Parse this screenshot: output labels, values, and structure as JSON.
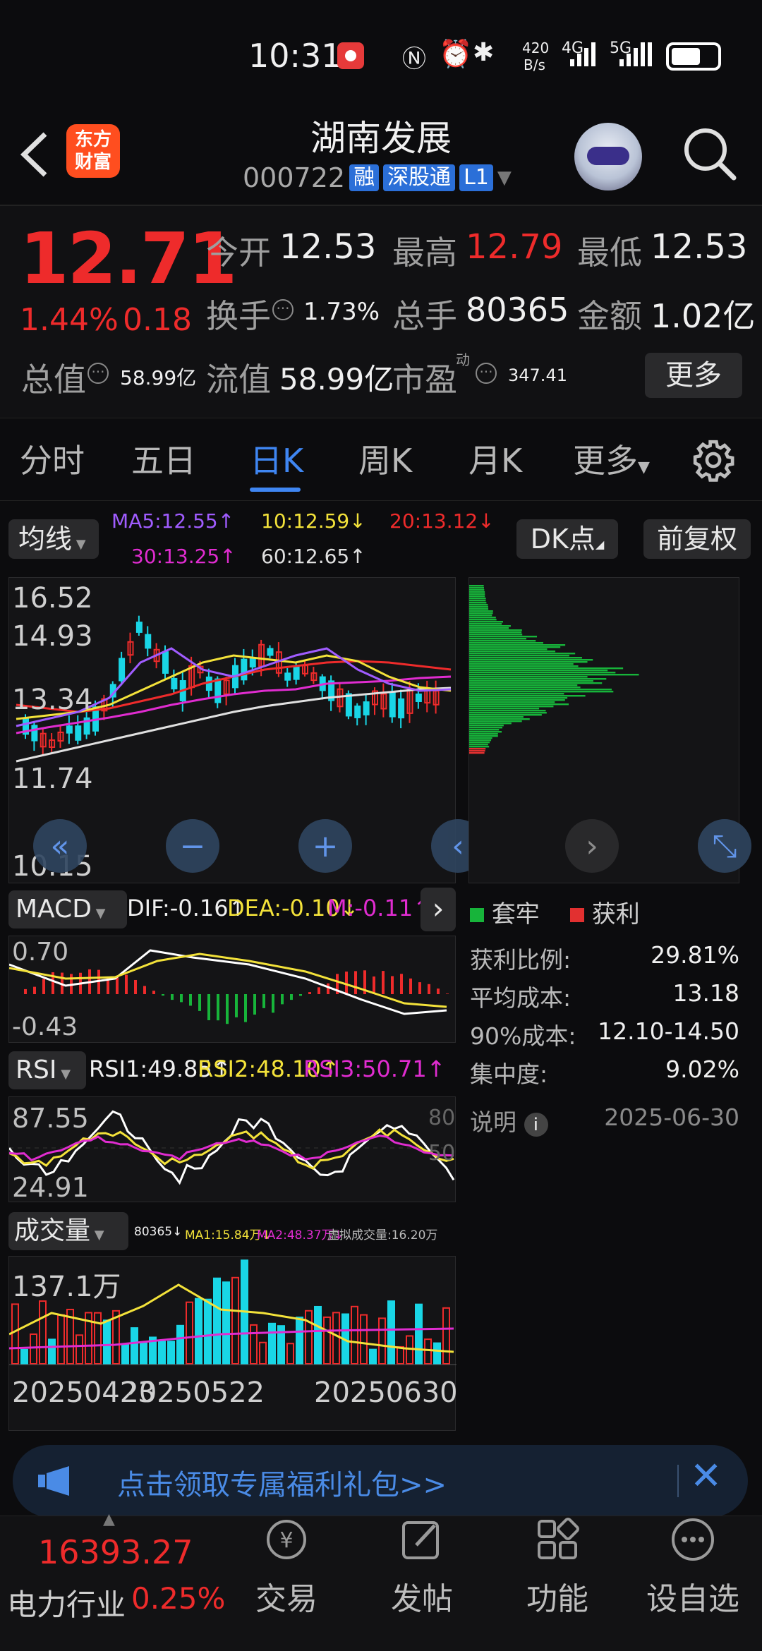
{
  "status_bar": {
    "time": "10:31",
    "net_speed_top": "420",
    "net_speed_bottom": "B/s",
    "sig1": "4G",
    "sig2": "5G"
  },
  "header": {
    "title": "湖南发展",
    "code": "000722",
    "badges": [
      "融",
      "深股通",
      "L1"
    ],
    "logo_line1": "东方",
    "logo_line2": "财富"
  },
  "quote": {
    "price": "12.71",
    "change_pct": "1.44%",
    "change": "0.18",
    "open_label": "今开",
    "open": "12.53",
    "high_label": "最高",
    "high": "12.79",
    "low_label": "最低",
    "low": "12.53",
    "turnover_label": "换手",
    "turnover": "1.73%",
    "volume_label": "总手",
    "volume": "80365",
    "amount_label": "金额",
    "amount": "1.02亿",
    "mktcap_label": "总值",
    "mktcap": "58.99亿",
    "float_label": "流值",
    "float": "58.99亿",
    "pe_label": "市盈",
    "pe_sup": "动",
    "pe": "347.41",
    "more_btn": "更多"
  },
  "tabs": [
    "分时",
    "五日",
    "日K",
    "周K",
    "月K",
    "更多"
  ],
  "active_tab": 2,
  "ma_bar": {
    "selector": "均线",
    "ma5": "MA5:12.55↑",
    "ma10": "10:12.59↓",
    "ma20": "20:13.12↓",
    "ma30": "30:13.25↑",
    "ma60": "60:12.65↑",
    "dk_btn": "DK点",
    "fq_btn": "前复权"
  },
  "kline": {
    "y_labels": [
      "16.52",
      "14.93",
      "13.34",
      "11.74",
      "10.15"
    ]
  },
  "macd": {
    "selector": "MACD",
    "dif": "DIF:-0.16↑",
    "dea": "DEA:-0.10↓",
    "m": "M:-0.11↑",
    "y_top": "0.70",
    "y_bottom": "-0.43"
  },
  "rsi": {
    "selector": "RSI",
    "rsi1": "RSI1:49.85↑",
    "rsi2": "RSI2:48.10↑",
    "rsi3": "RSI3:50.71↑",
    "y_top": "87.55",
    "y_bottom": "24.91",
    "r80": "80",
    "r50": "50"
  },
  "vol": {
    "selector": "成交量",
    "info1": "80365↓",
    "info2": "MA1:15.84万↓",
    "info3": "MA2:48.37万↓",
    "info4": "虚拟成交量:16.20万",
    "y_top": "137.1万",
    "dates": [
      "20250423",
      "20250522",
      "20250630"
    ]
  },
  "chip": {
    "legend_loss": "套牢",
    "legend_profit": "获利",
    "rows": [
      {
        "label": "获利比例:",
        "value": "29.81%"
      },
      {
        "label": "平均成本:",
        "value": "13.18"
      },
      {
        "label": "90%成本:",
        "value": "12.10-14.50"
      },
      {
        "label": "集中度:",
        "value": "9.02%"
      }
    ],
    "note_label": "说明",
    "note_date": "2025-06-30"
  },
  "banner": {
    "text": "点击领取专属福利礼包>>"
  },
  "bottom_nav": {
    "index_value": "16393.27",
    "index_name": "电力行业",
    "index_change": "0.25%",
    "items": [
      "交易",
      "发帖",
      "功能",
      "设自选"
    ]
  },
  "colors": {
    "up": "#ee2b2b",
    "down": "#19d6e6",
    "accent": "#2b6fd8",
    "ma5": "#a05cff",
    "ma10": "#f3e23a",
    "ma20": "#ee2b2b",
    "ma30": "#e02cd0",
    "ma60": "#e0e0e0"
  }
}
